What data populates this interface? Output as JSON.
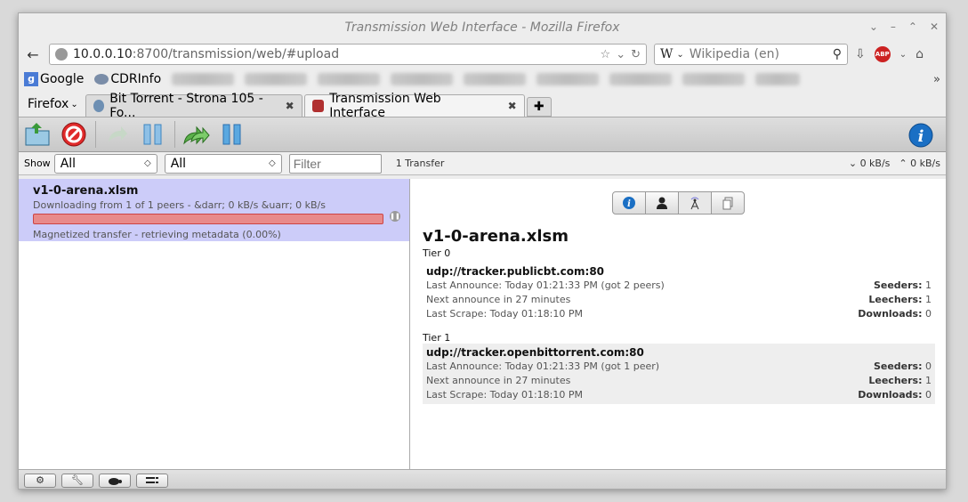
{
  "window": {
    "title": "Transmission Web Interface - Mozilla Firefox"
  },
  "urlbar": {
    "host": "10.0.0.10",
    "rest": ":8700/transmission/web/#upload"
  },
  "search": {
    "engine_label": "W",
    "placeholder": "Wikipedia (en)"
  },
  "bookmarks": [
    {
      "label": "Google"
    },
    {
      "label": "CDRInfo"
    }
  ],
  "firefox_menu": "Firefox",
  "tabs": [
    {
      "label": "Bit Torrent - Strona 105 - Fo..."
    },
    {
      "label": "Transmission Web Interface"
    }
  ],
  "filter": {
    "show_label": "Show",
    "state_value": "All",
    "tracker_value": "All",
    "filter_placeholder": "Filter",
    "transfer_count": "1 Transfer",
    "down_speed": "0 kB/s",
    "up_speed": "0 kB/s"
  },
  "torrent": {
    "name": "v1-0-arena.xlsm",
    "peers_line": "Downloading from 1 of 1 peers - &darr; 0 kB/s &uarr; 0 kB/s",
    "meta_line": "Magnetized transfer - retrieving metadata (0.00%)",
    "progress": 1.0
  },
  "inspector": {
    "name": "v1-0-arena.xlsm",
    "tiers": [
      {
        "label": "Tier 0",
        "tracker": "udp://tracker.publicbt.com:80",
        "last_announce": "Last Announce: Today 01:21:33 PM (got 2 peers)",
        "next_announce": "Next announce in 27 minutes",
        "last_scrape": "Last Scrape: Today 01:18:10 PM",
        "seeders_label": "Seeders:",
        "seeders": "1",
        "leechers_label": "Leechers:",
        "leechers": "1",
        "downloads_label": "Downloads:",
        "downloads": "0"
      },
      {
        "label": "Tier 1",
        "tracker": "udp://tracker.openbittorrent.com:80",
        "last_announce": "Last Announce: Today 01:21:33 PM (got 1 peer)",
        "next_announce": "Next announce in 27 minutes",
        "last_scrape": "Last Scrape: Today 01:18:10 PM",
        "seeders_label": "Seeders:",
        "seeders": "0",
        "leechers_label": "Leechers:",
        "leechers": "1",
        "downloads_label": "Downloads:",
        "downloads": "0"
      }
    ]
  },
  "colors": {
    "selected_row": "#ccccf9",
    "progress_fill": "#e88a8a",
    "info_blue": "#1a6fc4"
  }
}
